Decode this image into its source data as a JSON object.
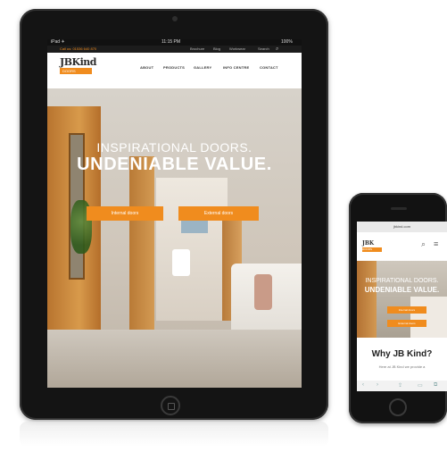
{
  "tablet": {
    "status": {
      "left": "iPad ✈",
      "time": "11:15 PM",
      "battery": "100%"
    },
    "topbar": {
      "phone": "Call us: 01536 640 870",
      "links": [
        "Brochure",
        "Blog",
        "Workwear",
        "Search"
      ]
    },
    "nav": {
      "logo_text": "JBKind",
      "logo_sub": "DOORS",
      "items": [
        "ABOUT",
        "PRODUCTS",
        "GALLERY",
        "INFO CENTRE",
        "CONTACT"
      ]
    },
    "hero": {
      "line1": "INSPIRATIONAL DOORS.",
      "line2": "UNDENIABLE VALUE.",
      "buttons": [
        "Internal doors",
        "External doors"
      ]
    }
  },
  "phone": {
    "url": "jbkind.com",
    "nav": {
      "logo_text": "JBK",
      "logo_sub": "DOORS"
    },
    "hero": {
      "line1": "INSPIRATIONAL DOORS.",
      "line2": "UNDENIABLE VALUE.",
      "buttons": [
        "Internal doors",
        "External doors"
      ]
    },
    "section_title": "Why JB Kind?",
    "section_text": "Here at JB Kind we provide a"
  },
  "colors": {
    "accent": "#f08c1e",
    "device": "#141414"
  }
}
